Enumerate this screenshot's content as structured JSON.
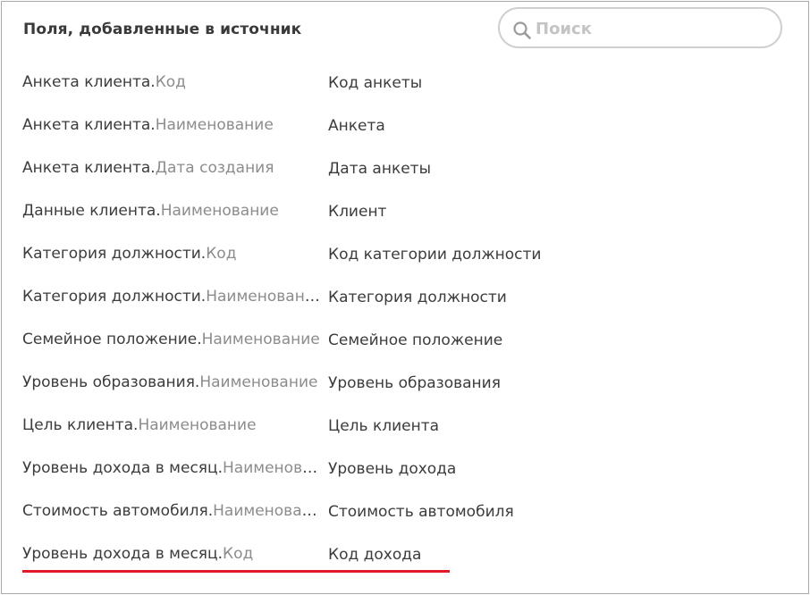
{
  "header": {
    "title": "Поля, добавленные в источник",
    "search_placeholder": "Поиск",
    "search_value": ""
  },
  "fields": [
    {
      "table": "Анкета клиента.",
      "field": "Код",
      "alias": "Код анкеты"
    },
    {
      "table": "Анкета клиента.",
      "field": "Наименование",
      "alias": "Анкета"
    },
    {
      "table": "Анкета клиента.",
      "field": "Дата создания",
      "alias": "Дата анкеты"
    },
    {
      "table": "Данные клиента.",
      "field": "Наименование",
      "alias": "Клиент"
    },
    {
      "table": "Категория должности.",
      "field": "Код",
      "alias": "Код категории должности"
    },
    {
      "table": "Категория должности.",
      "field": "Наименование",
      "alias": "Категория должности"
    },
    {
      "table": "Семейное положение.",
      "field": "Наименование",
      "alias": "Семейное положение"
    },
    {
      "table": "Уровень образования.",
      "field": "Наименование",
      "alias": "Уровень образования"
    },
    {
      "table": "Цель клиента.",
      "field": "Наименование",
      "alias": "Цель клиента"
    },
    {
      "table": "Уровень дохода в месяц.",
      "field": "Наименование",
      "alias": "Уровень дохода"
    },
    {
      "table": "Стоимость автомобиля.",
      "field": "Наименование",
      "alias": "Стоимость автомобиля"
    },
    {
      "table": "Уровень дохода в месяц.",
      "field": "Код",
      "alias": "Код дохода",
      "highlighted": true
    }
  ],
  "colors": {
    "highlight_underline": "#e01a28",
    "field_name": "#8c8c8c",
    "text": "#3c3c3c"
  },
  "icons": {
    "search": "search-icon"
  }
}
